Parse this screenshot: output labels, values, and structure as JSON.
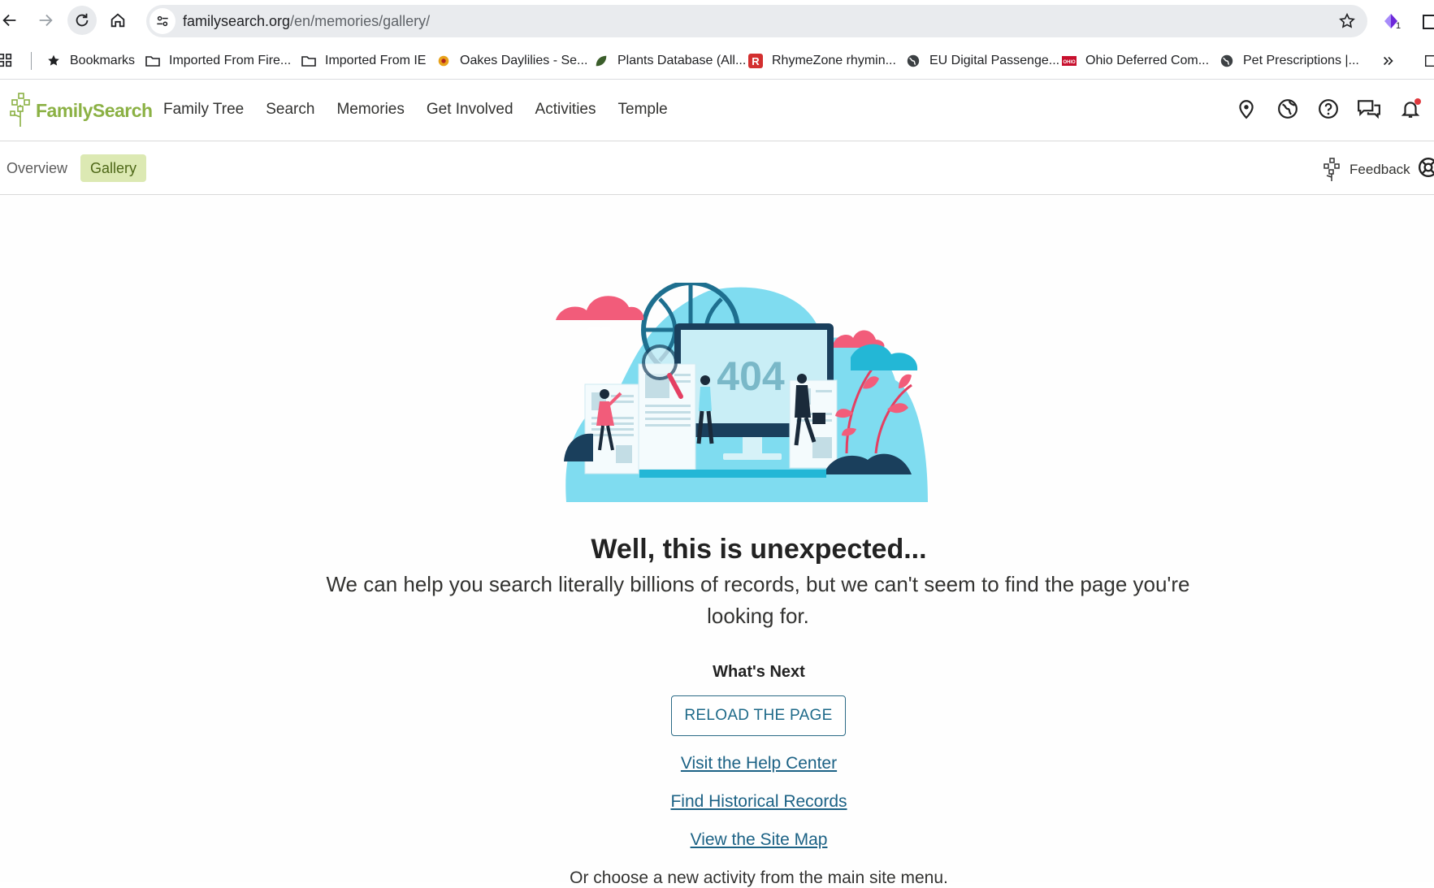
{
  "browser": {
    "url_host": "familysearch.org",
    "url_path": "/en/memories/gallery/",
    "extension_badge": "1",
    "bookmarks": [
      {
        "label": "Bookmarks",
        "icon": "star-icon"
      },
      {
        "label": "Imported From Fire...",
        "icon": "folder-icon"
      },
      {
        "label": "Imported From IE",
        "icon": "folder-icon"
      },
      {
        "label": "Oakes Daylilies - Se...",
        "icon": "flower-icon"
      },
      {
        "label": "Plants Database (All...",
        "icon": "leaf-icon"
      },
      {
        "label": "RhymeZone rhymin...",
        "icon": "rhymezone-icon"
      },
      {
        "label": "EU Digital Passenge...",
        "icon": "globe-icon"
      },
      {
        "label": "Ohio Deferred Com...",
        "icon": "ohio-icon"
      },
      {
        "label": "Pet Prescriptions |...",
        "icon": "globe-icon"
      }
    ]
  },
  "header": {
    "logo_text": "FamilySearch",
    "nav": [
      "Family Tree",
      "Search",
      "Memories",
      "Get Involved",
      "Activities",
      "Temple"
    ],
    "icons": [
      "location-pin-icon",
      "globe-icon",
      "help-icon",
      "messages-icon",
      "bell-icon"
    ]
  },
  "subnav": {
    "tabs": [
      "Overview",
      "Gallery"
    ],
    "active_tab": "Gallery",
    "feedback_label": "Feedback"
  },
  "error": {
    "illustration_text": "404",
    "heading": "Well, this is unexpected...",
    "message": "We can help you search literally billions of records, but we can't seem to find the page you're looking for.",
    "whats_next": "What's Next",
    "reload_label": "RELOAD THE PAGE",
    "links": [
      "Visit the Help Center",
      "Find Historical Records",
      "View the Site Map"
    ],
    "footer_text": "Or choose a new activity from the main site menu."
  },
  "colors": {
    "brand_green": "#8bb144",
    "active_tab_bg": "#dce9b3",
    "link_blue": "#1c6285",
    "illustration_cyan": "#7fdcf0",
    "illustration_pink": "#f25c7a"
  }
}
